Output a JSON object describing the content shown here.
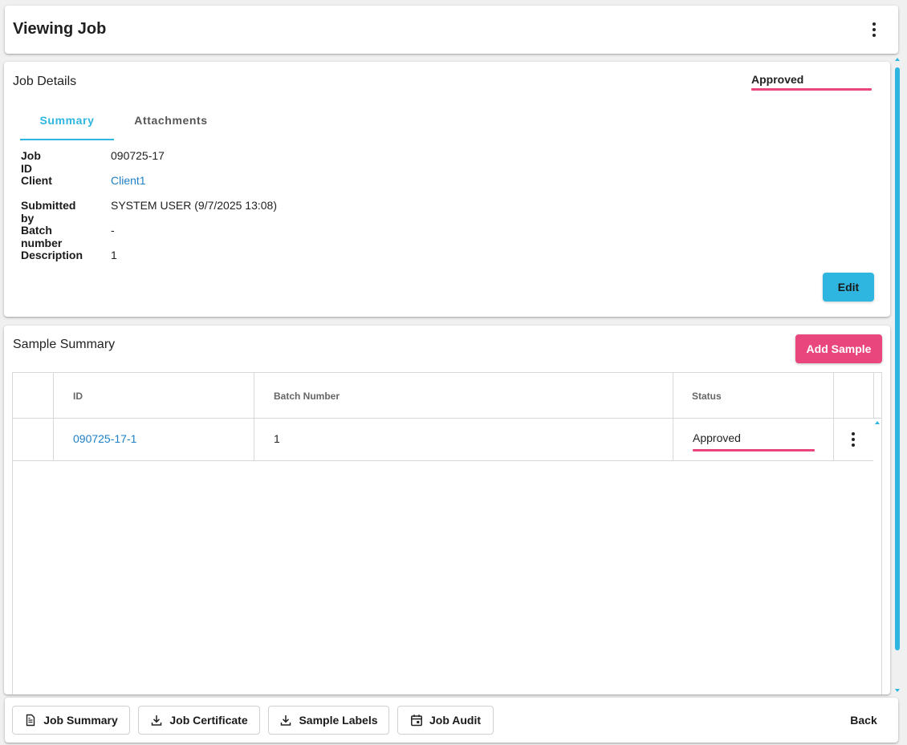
{
  "header": {
    "title": "Viewing Job"
  },
  "job_details": {
    "title": "Job Details",
    "status": "Approved",
    "tabs": [
      "Summary",
      "Attachments"
    ],
    "fields": [
      {
        "label": "Job ID",
        "value": "090725-17"
      },
      {
        "label": "Client",
        "value": "Client1"
      },
      {
        "label": "Submitted by",
        "value": "SYSTEM USER (9/7/2025 13:08)"
      },
      {
        "label": "Batch number",
        "value": "-"
      },
      {
        "label": "Description",
        "value": "1"
      }
    ],
    "edit_label": "Edit"
  },
  "sample_summary": {
    "title": "Sample Summary",
    "add_label": "Add Sample",
    "columns": [
      "ID",
      "Batch Number",
      "Status"
    ],
    "rows": [
      {
        "id": "090725-17-1",
        "batch_number": "1",
        "status": "Approved"
      }
    ]
  },
  "footer": {
    "buttons": [
      "Job Summary",
      "Job Certificate",
      "Sample Labels",
      "Job Audit"
    ],
    "back_label": "Back"
  },
  "colors": {
    "accent": "#2fb6e0",
    "status": "#e8467c",
    "link": "#1e7fc4"
  }
}
